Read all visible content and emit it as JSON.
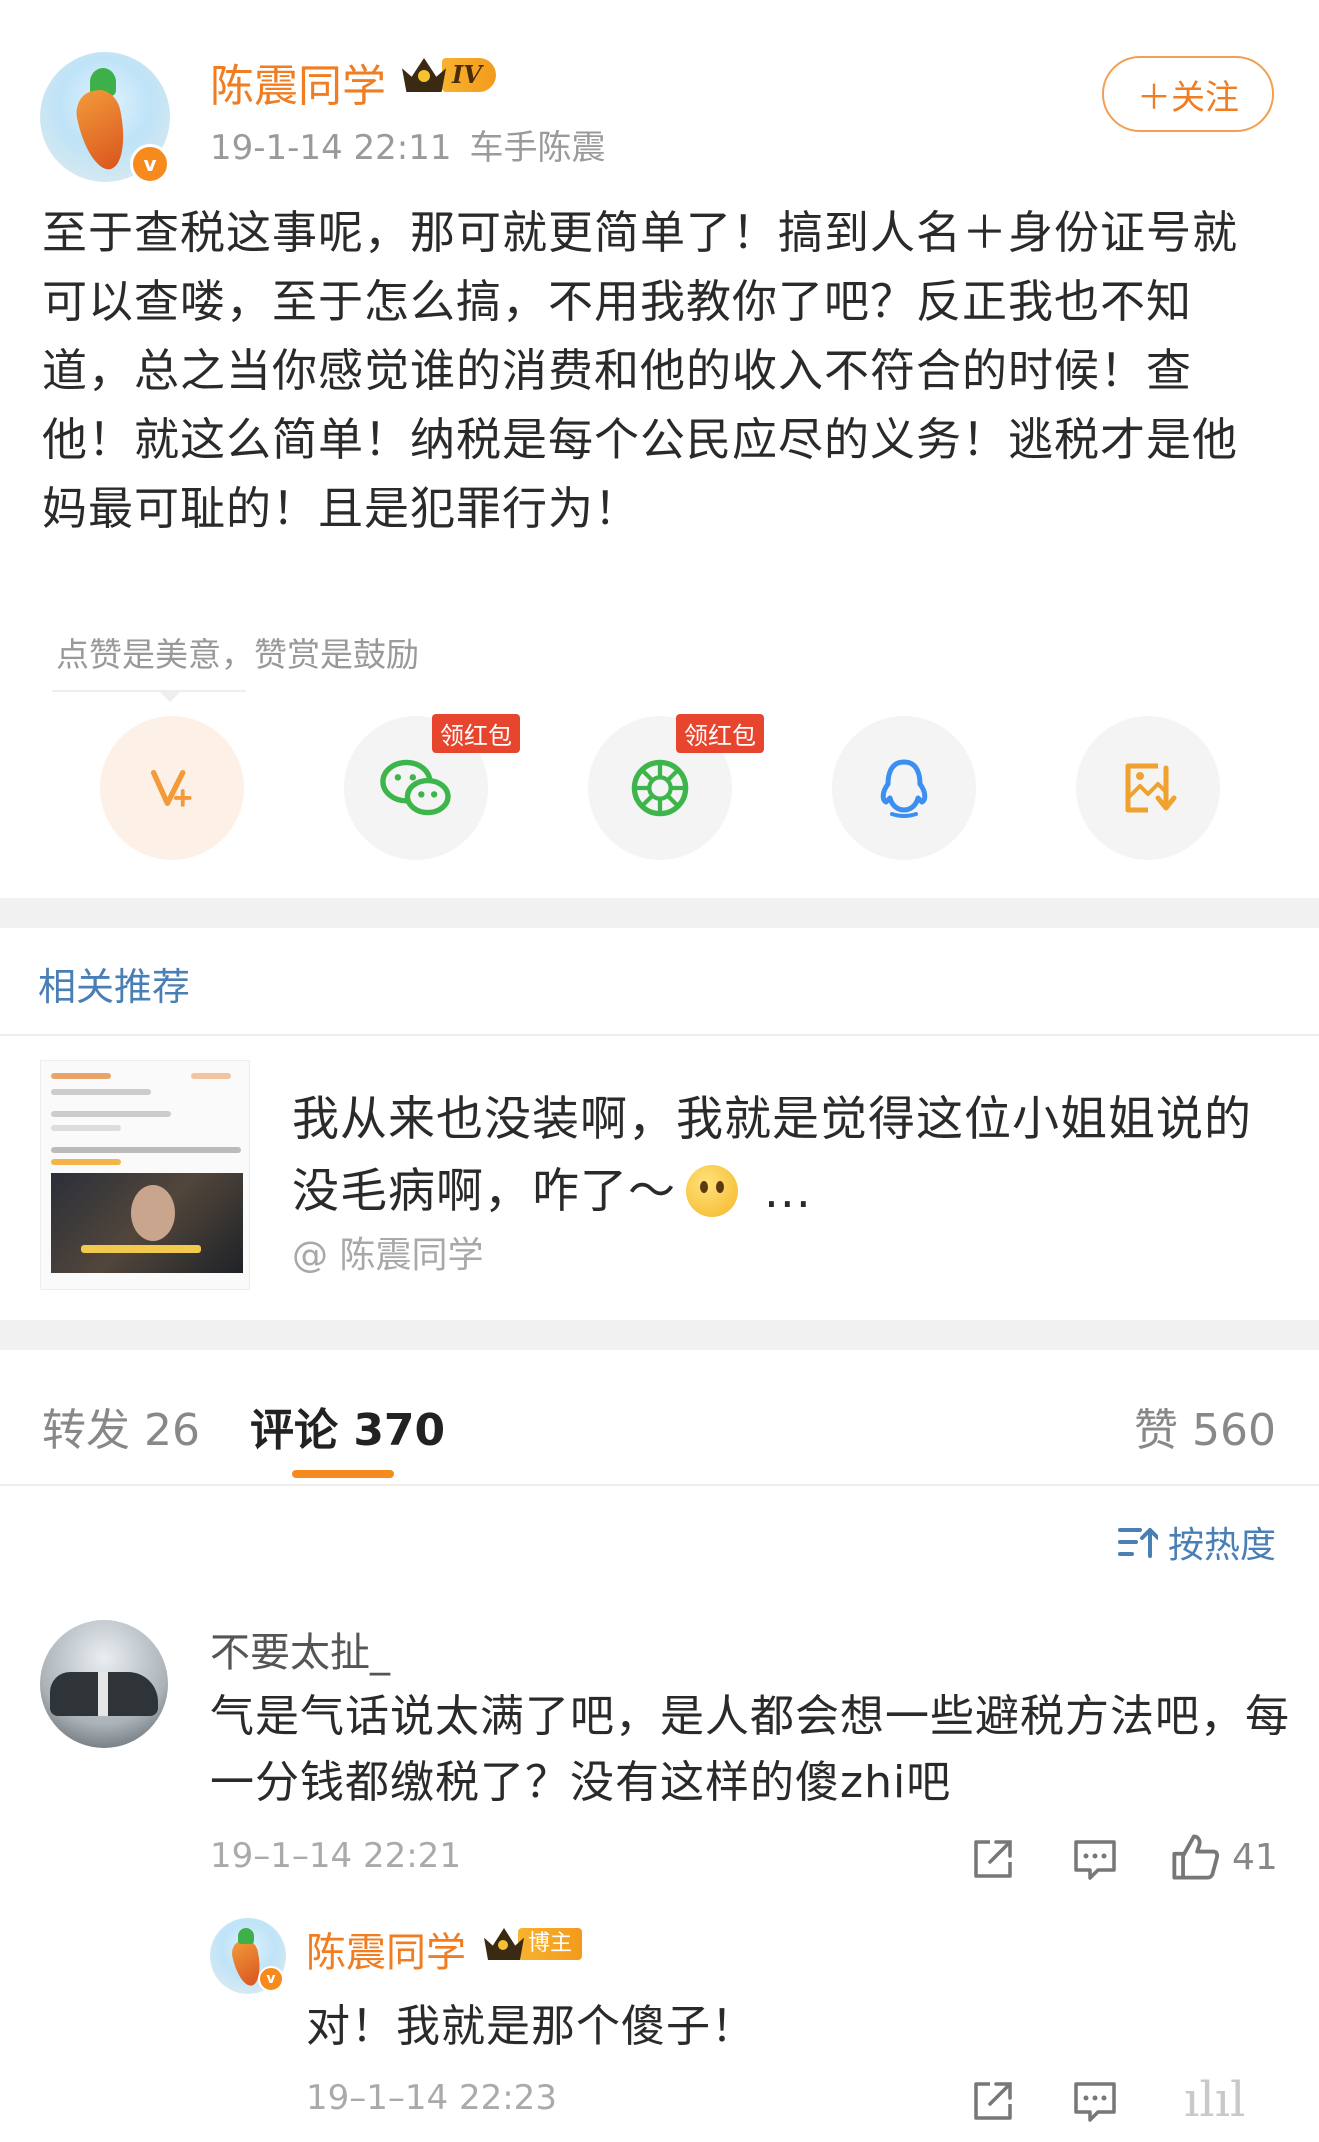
{
  "post": {
    "author": "陈震同学",
    "level": "IV",
    "time": "19-1-14 22:11",
    "source": "车手陈震",
    "follow_label": "＋关注",
    "verified_mark": "v",
    "body": "至于查税这事呢，那可就更简单了！搞到人名＋身份证号就可以查喽，至于怎么搞，不用我教你了吧？反正我也不知道，总之当你感觉谁的消费和他的收入不符合的时候！查他！就这么简单！纳税是每个公民应尽的义务！逃税才是他妈最可耻的！且是犯罪行为！"
  },
  "reward": {
    "hint": "点赞是美意，赞赏是鼓励",
    "share_buttons": [
      {
        "icon": "v-plus-reward-icon",
        "tag": ""
      },
      {
        "icon": "wechat-icon",
        "tag": "领红包"
      },
      {
        "icon": "moments-icon",
        "tag": "领红包"
      },
      {
        "icon": "qq-icon",
        "tag": ""
      },
      {
        "icon": "save-image-icon",
        "tag": ""
      }
    ]
  },
  "related": {
    "section_title": "相关推荐",
    "text_before_emoji": "我从来也没装啊，我就是觉得这位小姐姐说的没毛病啊，咋了～",
    "text_after_emoji": " ...",
    "author": "@ 陈震同学"
  },
  "tabs": {
    "repost": "转发 26",
    "comments": "评论 370",
    "likes": "赞 560"
  },
  "sort_label": "按热度",
  "comment": {
    "name": "不要太扯_",
    "text": "气是气话说太满了吧，是人都会想一些避税方法吧，每一分钱都缴税了？没有这样的傻zhi吧",
    "time": "19–1–14 22:21",
    "like_count": "41"
  },
  "reply": {
    "name": "陈震同学",
    "badge": "博主",
    "text": "对！我就是那个傻子！",
    "time": "19–1–14 22:23"
  },
  "colors": {
    "accent_orange": "#f07d22",
    "link_blue": "#4a7fb5",
    "red_tag": "#e8452f"
  }
}
